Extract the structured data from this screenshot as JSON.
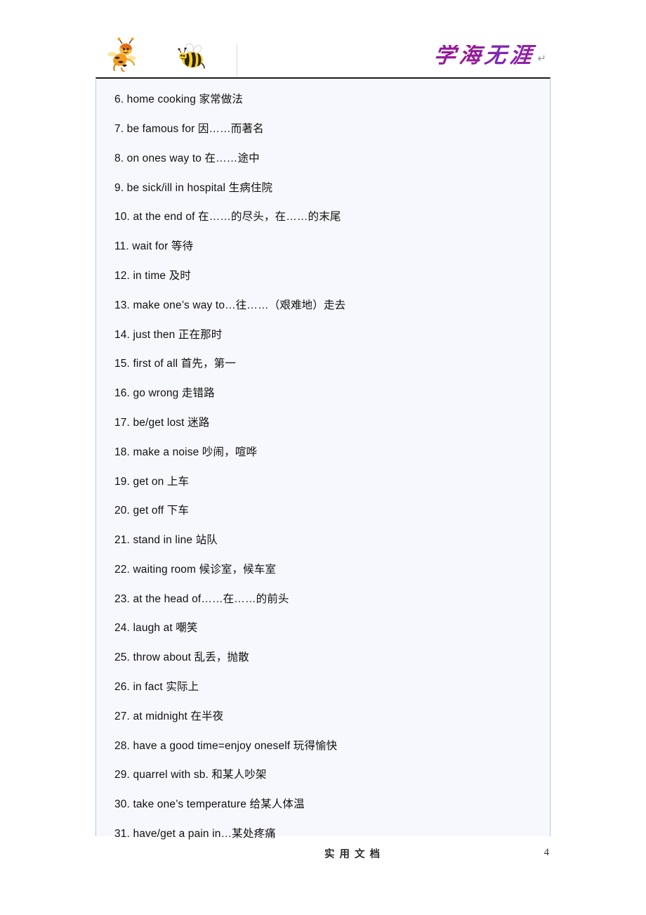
{
  "header": {
    "brand_text": "学海无涯",
    "brand_color": "#8e1fa8",
    "pilcrow": "↵",
    "bee_left_icon": "bee-character-icon",
    "bee_right_icon": "bee-icon"
  },
  "content": {
    "background_color": "#f7f8fd",
    "border_color": "#a9cfe4",
    "entries": [
      "6. home cooking  家常做法",
      "7. be famous for  因……而著名",
      "8. on ones way to 在……途中",
      "9. be sick/ill in hospital 生病住院",
      "10. at the end of 在……的尽头，在……的末尾",
      "11. wait for  等待",
      "12. in time  及时",
      "13. make one’s way to…往……（艰难地）走去",
      "14. just then  正在那时",
      "15. first of all  首先，第一",
      "16. go wrong  走错路",
      "17. be/get lost  迷路",
      "18. make a noise  吵闹，喧哗",
      "19. get on  上车",
      "20. get off  下车",
      "21. stand in line  站队",
      "22. waiting room  候诊室，候车室",
      "23. at the head of……在……的前头",
      "24. laugh at  嘲笑",
      "25. throw about  乱丢，抛散",
      "26. in fact  实际上",
      "27. at midnight  在半夜",
      "28. have a good time=enjoy oneself 玩得愉快",
      "29. quarrel with sb.  和某人吵架",
      "30. take one’s temperature  给某人体温",
      "31. have/get a pain in…某处疼痛"
    ]
  },
  "footer": {
    "label": "实用文档",
    "page_number": "4"
  }
}
